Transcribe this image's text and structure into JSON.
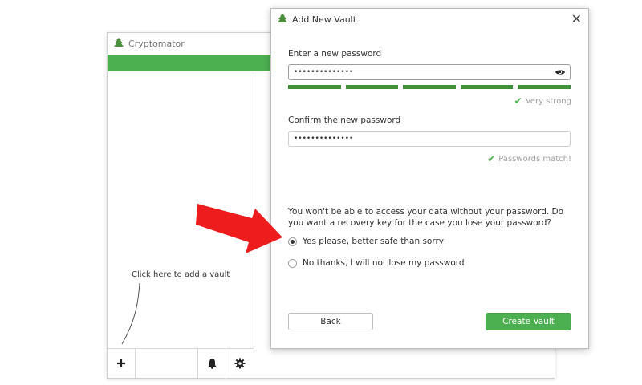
{
  "main_window": {
    "title": "Cryptomator",
    "hint": "Click here to add a vault",
    "accent_color": "#4caf50",
    "bottom_bar": {
      "add_icon": "plus-icon",
      "bell_icon": "bell-icon",
      "gear_icon": "gear-icon"
    }
  },
  "dialog": {
    "title": "Add New Vault",
    "close_icon": "close-icon",
    "password_label": "Enter a new password",
    "password_value": "••••••••••••••",
    "strength_text": "Very strong",
    "strength_level": 5,
    "strength_max": 5,
    "confirm_label": "Confirm the new password",
    "confirm_value": "••••••••••••••",
    "match_text": "Passwords match!",
    "recovery_question": "You won't be able to access your data without your password. Do you want a recovery key for the case you lose your password?",
    "options": [
      {
        "label": "Yes please, better safe than sorry",
        "selected": true
      },
      {
        "label": "No thanks, I will not lose my password",
        "selected": false
      }
    ],
    "back_label": "Back",
    "create_label": "Create Vault"
  },
  "annotation": {
    "arrow_color": "#ee1c1c"
  }
}
